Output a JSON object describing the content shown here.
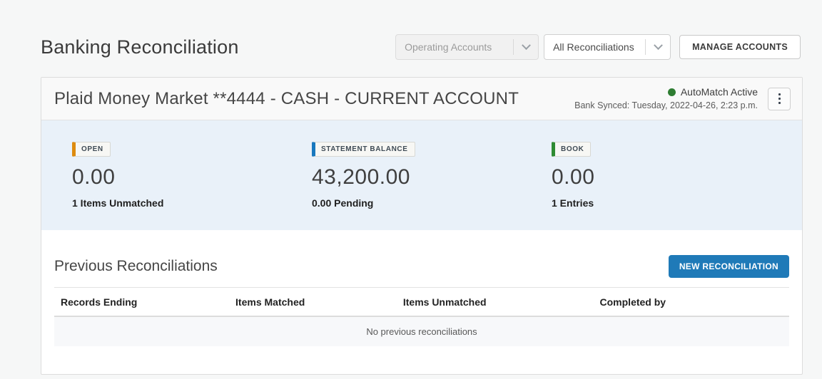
{
  "page": {
    "title": "Banking Reconciliation"
  },
  "toolbar": {
    "account_filter_value": "Operating Accounts",
    "reconciliation_filter_value": "All Reconciliations",
    "manage_accounts_label": "MANAGE ACCOUNTS"
  },
  "account_card": {
    "title": "Plaid Money Market **4444 - CASH - CURRENT ACCOUNT",
    "automatch_status": "AutoMatch Active",
    "bank_synced": "Bank Synced: Tuesday, 2022-04-26, 2:23 p.m.",
    "stats": [
      {
        "badge": "OPEN",
        "bar_color": "#dd8b0e",
        "value": "0.00",
        "sublabel": "1 Items Unmatched"
      },
      {
        "badge": "STATEMENT BALANCE",
        "bar_color": "#1878be",
        "value": "43,200.00",
        "sublabel": "0.00 Pending"
      },
      {
        "badge": "BOOK",
        "bar_color": "#2e8b32",
        "value": "0.00",
        "sublabel": "1 Entries"
      }
    ]
  },
  "previous_reconciliations": {
    "title": "Previous Reconciliations",
    "new_button_label": "NEW RECONCILIATION",
    "columns": [
      "Records Ending",
      "Items Matched",
      "Items Unmatched",
      "Completed by"
    ],
    "empty_message": "No previous reconciliations"
  },
  "colors": {
    "accent_blue": "#1f7ab8",
    "status_green": "#2e7d32",
    "stats_background": "#e9f1f9"
  }
}
